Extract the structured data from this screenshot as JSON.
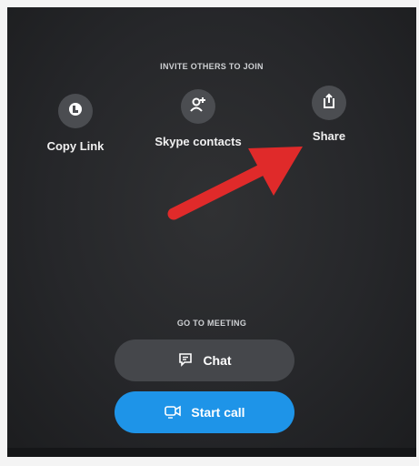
{
  "invite": {
    "heading": "INVITE OTHERS TO JOIN",
    "options": [
      {
        "label": "Copy Link",
        "icon": "link-icon"
      },
      {
        "label": "Skype contacts",
        "icon": "add-contact-icon"
      },
      {
        "label": "Share",
        "icon": "share-icon"
      }
    ]
  },
  "meeting": {
    "heading": "GO TO MEETING",
    "chat_label": "Chat",
    "chat_icon": "chat-icon",
    "call_label": "Start call",
    "call_icon": "video-call-icon"
  },
  "colors": {
    "background": "#26272a",
    "button_gray": "#45474b",
    "accent_blue": "#1e94e8",
    "annotation_arrow": "#e02a2a"
  }
}
